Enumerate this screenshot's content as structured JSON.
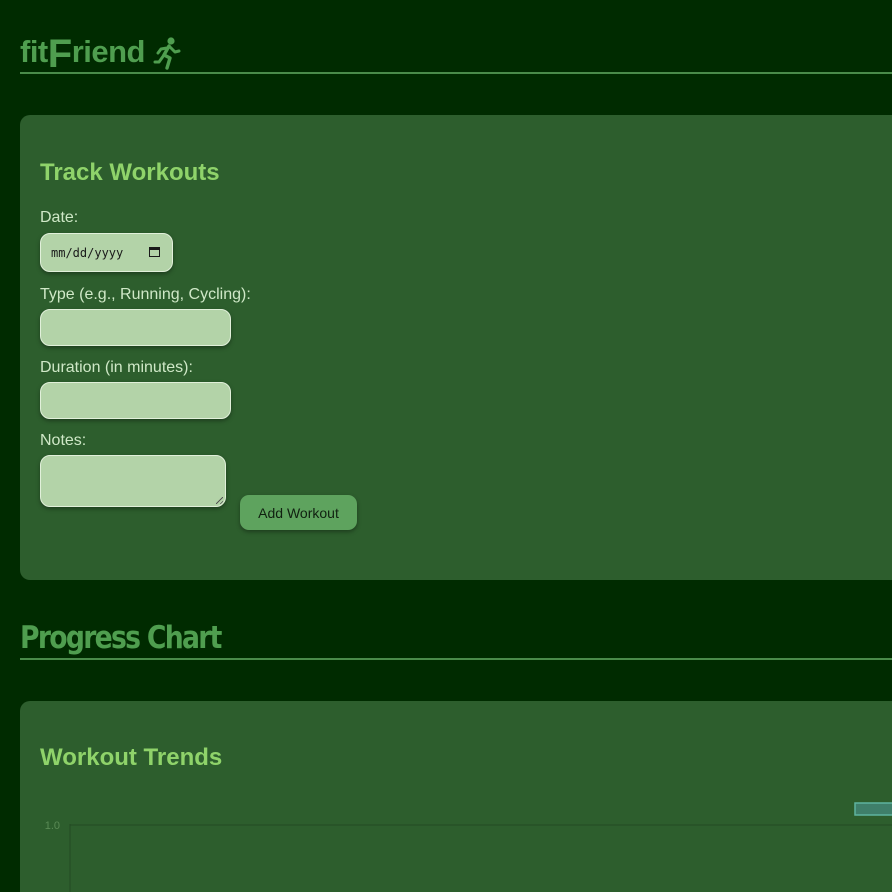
{
  "header": {
    "brand_pre": "fit",
    "brand_big": "F",
    "brand_post": "riend",
    "runner_icon": "running-person-icon"
  },
  "track_card": {
    "title": "Track Workouts",
    "date_label": "Date:",
    "date_placeholder": "mm/dd/yyyy",
    "type_label": "Type (e.g., Running, Cycling):",
    "type_value": "",
    "duration_label": "Duration (in minutes):",
    "duration_value": "",
    "notes_label": "Notes:",
    "notes_value": "",
    "add_button": "Add Workout"
  },
  "progress_section": {
    "title": "Progress Chart"
  },
  "trends_card": {
    "title": "Workout Trends"
  },
  "chart_data": {
    "type": "line",
    "title": "",
    "xlabel": "",
    "ylabel": "",
    "y_ticks": [
      "1.0"
    ],
    "ylim": [
      0,
      1.0
    ],
    "series": [],
    "legend": "top-right",
    "grid": true
  },
  "colors": {
    "background": "#002b00",
    "card": "#2d5e2d",
    "heading": "#8fd36a",
    "brand": "#4f9e4f",
    "input": "#b3d3a8",
    "button": "#5ea35e"
  }
}
